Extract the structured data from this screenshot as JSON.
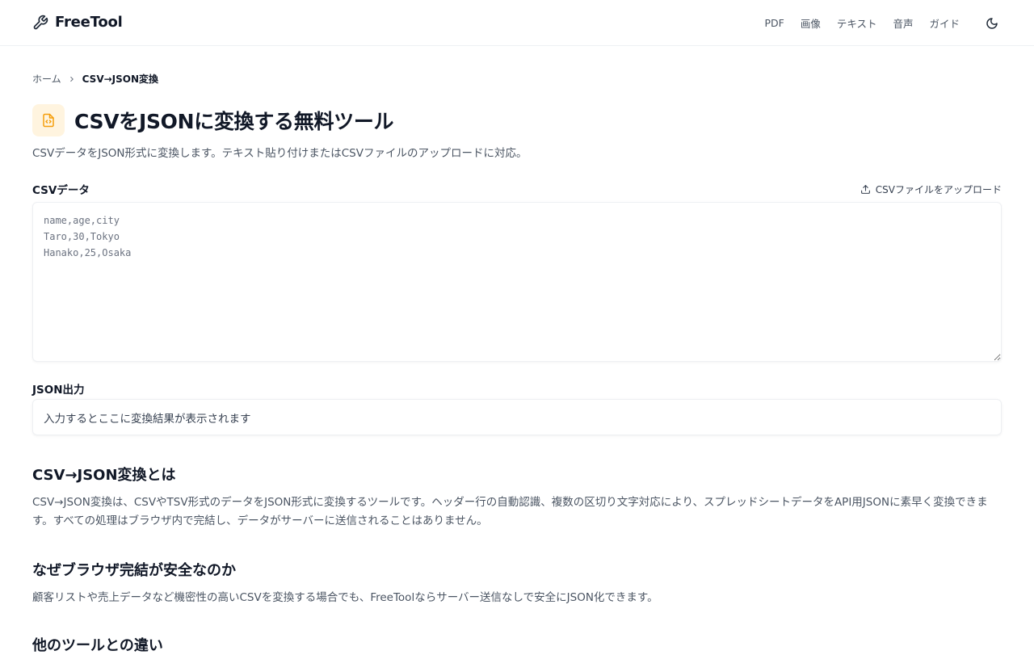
{
  "header": {
    "logo_text": "FreeTool",
    "nav": [
      "PDF",
      "画像",
      "テキスト",
      "音声",
      "ガイド"
    ]
  },
  "breadcrumb": {
    "home": "ホーム",
    "current": "CSV→JSON変換"
  },
  "page": {
    "title": "CSVをJSONに変換する無料ツール",
    "description": "CSVデータをJSON形式に変換します。テキスト貼り付けまたはCSVファイルのアップロードに対応。"
  },
  "csv": {
    "label": "CSVデータ",
    "upload_label": "CSVファイルをアップロード",
    "value": "",
    "placeholder": "name,age,city\nTaro,30,Tokyo\nHanako,25,Osaka"
  },
  "json_output": {
    "label": "JSON出力",
    "placeholder_text": "入力するとここに変換結果が表示されます"
  },
  "sections": [
    {
      "heading": "CSV→JSON変換とは",
      "body": "CSV→JSON変換は、CSVやTSV形式のデータをJSON形式に変換するツールです。ヘッダー行の自動認識、複数の区切り文字対応により、スプレッドシートデータをAPI用JSONに素早く変換できます。すべての処理はブラウザ内で完結し、データがサーバーに送信されることはありません。"
    },
    {
      "heading": "なぜブラウザ完結が安全なのか",
      "body": "顧客リストや売上データなど機密性の高いCSVを変換する場合でも、FreeToolならサーバー送信なしで安全にJSON化できます。"
    },
    {
      "heading": "他のツールとの違い"
    }
  ],
  "colors": {
    "accent": "#f59e0b",
    "icon_bg": "#fff4df"
  },
  "icons": {
    "logo": "wrench-icon",
    "theme": "moon-icon",
    "breadcrumb_sep": "chevron-right-icon",
    "title": "file-code-icon",
    "upload": "upload-icon"
  }
}
